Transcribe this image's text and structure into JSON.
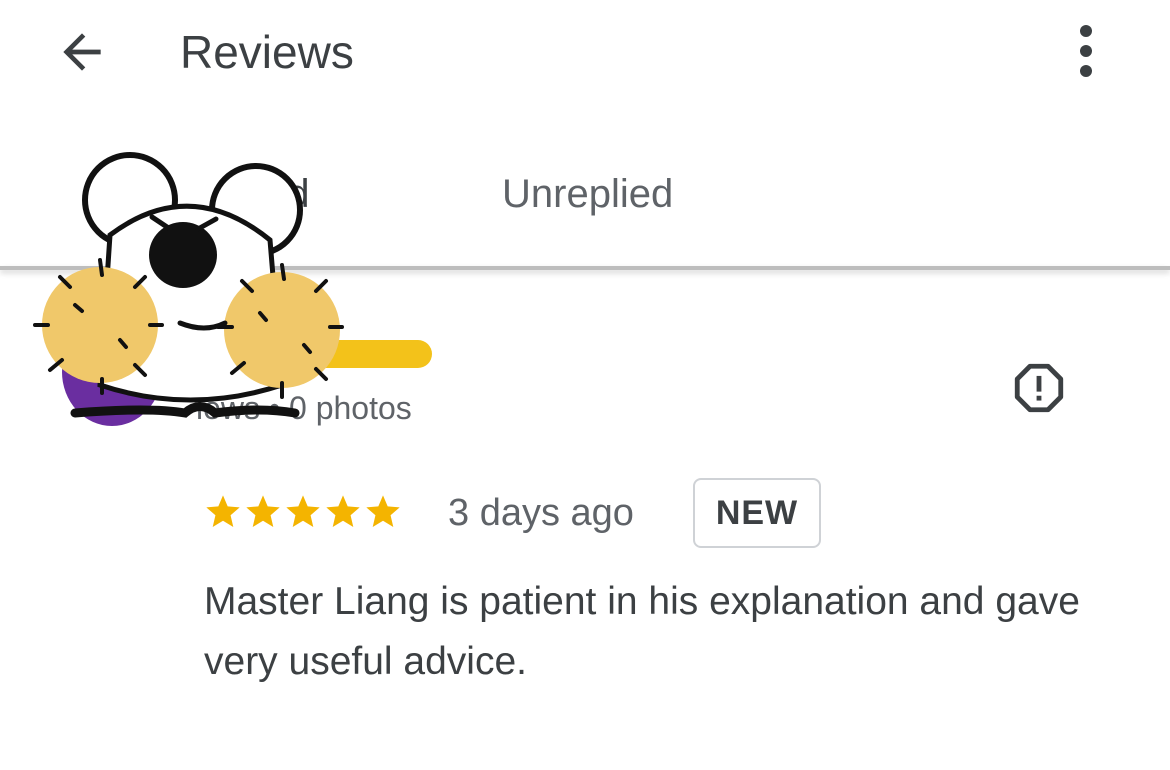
{
  "app_bar": {
    "title": "Reviews",
    "back_icon": "arrow-back-icon",
    "more_icon": "more-vert-icon"
  },
  "tabs": [
    {
      "label": "plied"
    },
    {
      "label": "Unreplied"
    }
  ],
  "review": {
    "reviewer_meta": "iews • 0 photos",
    "rating": 5,
    "time": "3 days ago",
    "badge": "NEW",
    "text": "Master Liang is patient in his explanation and gave very useful advice.",
    "flag_icon": "report-icon"
  },
  "colors": {
    "star": "#f4b400",
    "title_text": "#3c4043",
    "secondary_text": "#5f6368",
    "avatar": "#6a2ea0",
    "redaction_yellow": "#f3c21a",
    "sticker_fur": "#f0c86a"
  },
  "overlay": {
    "sticker_icon": "cartoon-mouse-sticker-icon"
  }
}
